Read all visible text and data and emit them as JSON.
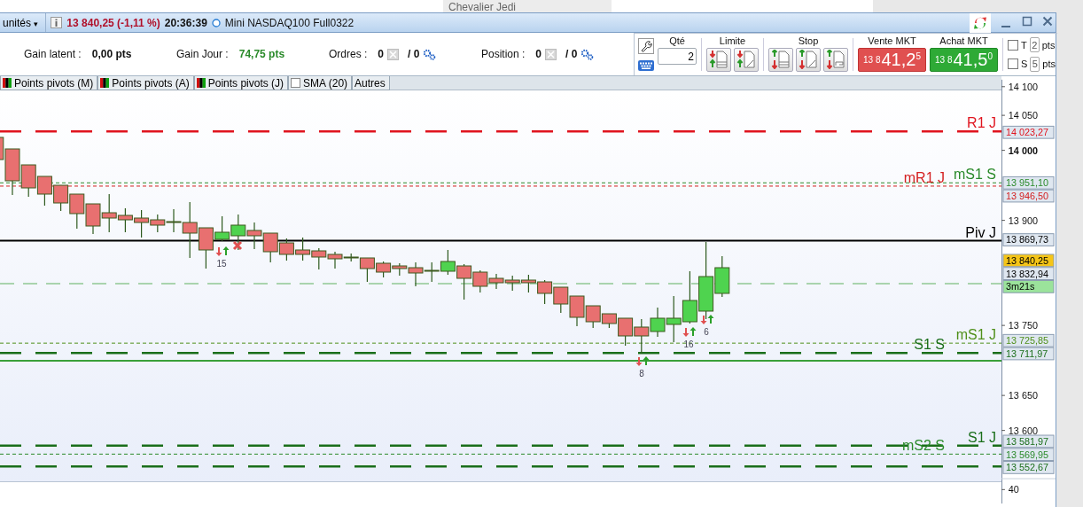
{
  "top_strip": {
    "tab_label": "Chevalier Jedi"
  },
  "window": {
    "units_menu": "unités",
    "units_caret": "▾",
    "price_change": "13 840,25 (-1,11 %)",
    "time": "20:36:39",
    "instrument": "Mini NASDAQ100 Full0322"
  },
  "summary": [
    {
      "label": "Gain latent :",
      "value": "0,00 pts",
      "kind": "plain"
    },
    {
      "label": "Gain Jour :",
      "value": "74,75 pts",
      "kind": "positive"
    },
    {
      "label": "Ordres :",
      "value": "0",
      "kind": "count",
      "total": "/ 0"
    },
    {
      "label": "Position :",
      "value": "0",
      "kind": "count",
      "total": "/ 0"
    }
  ],
  "order_panel": {
    "quantity_label": "Qté",
    "quantity": "2",
    "limit_label": "Limite",
    "stop_label": "Stop",
    "sell": {
      "label": "Vente MKT",
      "prefix": "13 8",
      "main": "41,2",
      "sup": "5"
    },
    "buy": {
      "label": "Achat MKT",
      "prefix": "13 8",
      "main": "41,5",
      "sup": "0"
    },
    "options": [
      {
        "label": "T",
        "checked": false,
        "value": "2",
        "unit": "pts"
      },
      {
        "label": "S",
        "checked": false,
        "value": "5",
        "unit": "pts"
      }
    ]
  },
  "indicator_tabs": [
    {
      "label": "Points pivots (M)",
      "kind": "pivot"
    },
    {
      "label": "Points pivots (A)",
      "kind": "pivot"
    },
    {
      "label": "Points pivots (J)",
      "kind": "pivot"
    },
    {
      "label": "SMA (20)",
      "kind": "checkbox",
      "checked": false
    },
    {
      "label": "Autres",
      "kind": "plain"
    }
  ],
  "chart": {
    "levels": [
      {
        "label": "R1 J",
        "price": "14 023,27",
        "color": "#e0141e",
        "kind": "long-dash"
      },
      {
        "label": "mS1 S",
        "price": "13 951,10",
        "color": "#2a8a2a",
        "kind": "short-dash"
      },
      {
        "label": "mR1 J",
        "price": "13 946,50",
        "color": "#d42020",
        "kind": "short-dash"
      },
      {
        "label": "Piv J",
        "price": "13 869,73",
        "color": "#000000",
        "kind": "solid"
      },
      {
        "label": "mS1 J",
        "price": "13 725,85",
        "color": "#4f8f1a",
        "kind": "short-dash"
      },
      {
        "label": "S1 S",
        "price": "13 711,97",
        "color": "#1a6e1a",
        "kind": "long-dash"
      },
      {
        "label": "S1 J",
        "price": "13 581,97",
        "color": "#1a6e1a",
        "kind": "long-dash"
      },
      {
        "label": "mS2 S",
        "price": "13 569,95",
        "color": "#2a8a2a",
        "kind": "short-dash"
      },
      {
        "price": "13 552,67",
        "color": "#1a6e1a",
        "kind": "long-dash"
      }
    ],
    "signals": [
      "15",
      "8",
      "16",
      "6"
    ]
  },
  "axis": {
    "ticks": [
      {
        "label": "14 100",
        "bold": false
      },
      {
        "label": "14 050",
        "bold": false
      },
      {
        "label": "14 000",
        "bold": true
      },
      {
        "label": "13 900",
        "bold": false
      },
      {
        "label": "13 750",
        "bold": false
      },
      {
        "label": "13 650",
        "bold": false
      },
      {
        "label": "13 600",
        "bold": false
      }
    ],
    "tags": [
      {
        "text": "13 840,25",
        "kind": "last"
      },
      {
        "text": "13 832,94",
        "kind": "plain"
      },
      {
        "text": "3m21s",
        "kind": "timer"
      }
    ],
    "lower_ticks": [
      "40"
    ]
  }
}
